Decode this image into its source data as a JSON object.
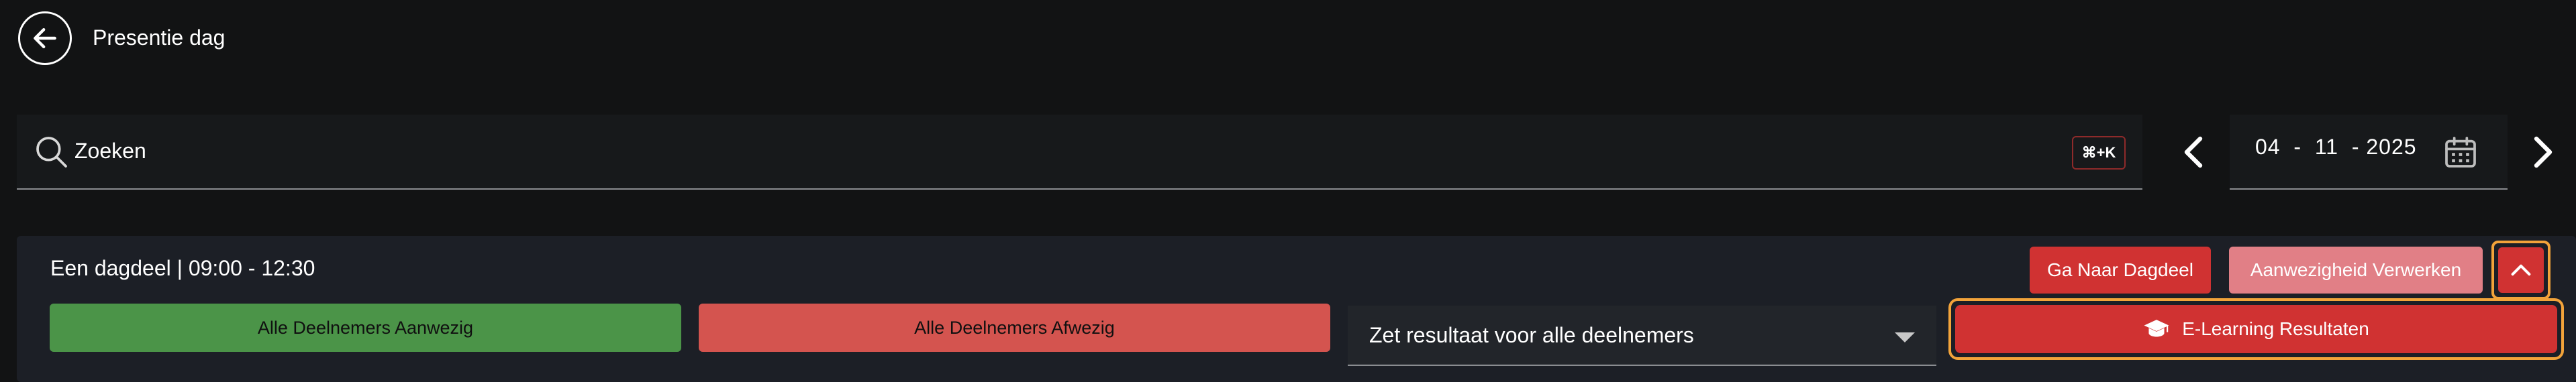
{
  "header": {
    "title": "Presentie dag"
  },
  "search": {
    "placeholder": "Zoeken",
    "shortcut": "⌘+K"
  },
  "date_nav": {
    "day": "04",
    "month": "11",
    "year": "2025",
    "display": "04  -  11  - 2025"
  },
  "session": {
    "title": "Een dagdeel | 09:00 - 12:30",
    "goto_label": "Ga Naar Dagdeel",
    "process_label": "Aanwezigheid Verwerken",
    "all_present_label": "Alle Deelnemers Aanwezig",
    "all_absent_label": "Alle Deelnemers Afwezig",
    "result_select_label": "Zet resultaat voor alle deelnemers",
    "elearning_label": "E-Learning Resultaten"
  },
  "colors": {
    "background": "#121314",
    "card": "#1c1f26",
    "primary_red": "#d03232",
    "light_red": "#e17f86",
    "green": "#4b9448",
    "focus_outline": "#f2a33a"
  },
  "icons": {
    "back": "arrow-left-circle-icon",
    "search": "search-icon",
    "prev": "chevron-left-icon",
    "next": "chevron-right-icon",
    "calendar": "calendar-icon",
    "collapse": "chevron-up-icon",
    "elearning": "graduation-cap-icon",
    "dropdown": "caret-down-icon"
  }
}
